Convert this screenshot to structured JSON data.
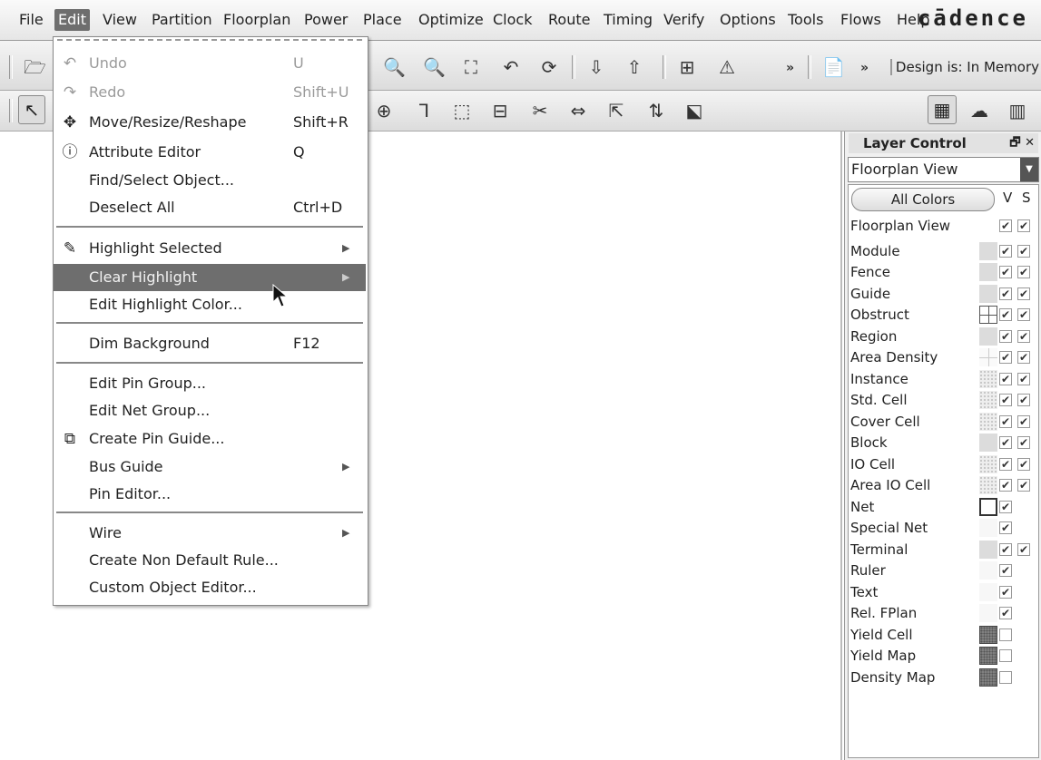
{
  "menubar": {
    "items": [
      "File",
      "Edit",
      "View",
      "Partition",
      "Floorplan",
      "Power",
      "Place",
      "Optimize",
      "Clock",
      "Route",
      "Timing",
      "Verify",
      "Options",
      "Tools",
      "Flows",
      "Help"
    ],
    "active": "Edit",
    "logo": "cādence"
  },
  "toolbar": {
    "design_status": "Design is: In Memory",
    "more_label": "»"
  },
  "edit_menu": {
    "items": [
      {
        "label": "Undo",
        "shortcut": "U",
        "icon": "undo-icon",
        "disabled": true
      },
      {
        "label": "Redo",
        "shortcut": "Shift+U",
        "icon": "redo-icon",
        "disabled": true
      },
      {
        "label": "Move/Resize/Reshape",
        "shortcut": "Shift+R",
        "icon": "move-icon"
      },
      {
        "label": "Attribute Editor",
        "shortcut": "Q",
        "icon": "info-icon"
      },
      {
        "label": "Find/Select Object...",
        "shortcut": ""
      },
      {
        "label": "Deselect All",
        "shortcut": "Ctrl+D"
      },
      {
        "label": "Highlight Selected",
        "shortcut": "",
        "icon": "highlight-icon",
        "submenu": true
      },
      {
        "label": "Clear Highlight",
        "shortcut": "",
        "submenu": true,
        "highlighted": true
      },
      {
        "label": "Edit Highlight Color...",
        "shortcut": ""
      },
      {
        "label": "Dim Background",
        "shortcut": "F12"
      },
      {
        "label": "Edit Pin Group...",
        "shortcut": ""
      },
      {
        "label": "Edit Net Group...",
        "shortcut": ""
      },
      {
        "label": "Create Pin Guide...",
        "shortcut": "",
        "icon": "pin-guide-icon"
      },
      {
        "label": "Bus Guide",
        "shortcut": "",
        "submenu": true
      },
      {
        "label": "Pin Editor...",
        "shortcut": ""
      },
      {
        "label": "Wire",
        "shortcut": "",
        "submenu": true
      },
      {
        "label": "Create Non Default Rule...",
        "shortcut": ""
      },
      {
        "label": "Custom Object Editor...",
        "shortcut": ""
      }
    ]
  },
  "layer_control": {
    "title": "Layer Control",
    "title_controls": "🗗 ✕",
    "view_select": "Floorplan View",
    "all_colors_label": "All Colors",
    "col_v": "V",
    "col_s": "S",
    "check_mark": "✔",
    "layers": [
      {
        "name": "Floorplan View",
        "swatch": "none",
        "v": true,
        "s": true
      },
      {
        "name": "Module",
        "swatch": "light",
        "v": true,
        "s": true
      },
      {
        "name": "Fence",
        "swatch": "light",
        "v": true,
        "s": true
      },
      {
        "name": "Guide",
        "swatch": "light",
        "v": true,
        "s": true
      },
      {
        "name": "Obstruct",
        "swatch": "grid",
        "v": true,
        "s": true
      },
      {
        "name": "Region",
        "swatch": "light",
        "v": true,
        "s": true
      },
      {
        "name": "Area Density",
        "swatch": "cross",
        "v": true,
        "s": true
      },
      {
        "name": "Instance",
        "swatch": "dot",
        "v": true,
        "s": true
      },
      {
        "name": "Std. Cell",
        "swatch": "dot",
        "v": true,
        "s": true
      },
      {
        "name": "Cover Cell",
        "swatch": "dot",
        "v": true,
        "s": true
      },
      {
        "name": "Block",
        "swatch": "light",
        "v": true,
        "s": true
      },
      {
        "name": "IO Cell",
        "swatch": "dot",
        "v": true,
        "s": true
      },
      {
        "name": "Area IO Cell",
        "swatch": "dot",
        "v": true,
        "s": true
      },
      {
        "name": "Net",
        "swatch": "outline",
        "v": true,
        "s": null
      },
      {
        "name": "Special Net",
        "swatch": "white",
        "v": true,
        "s": null
      },
      {
        "name": "Terminal",
        "swatch": "light",
        "v": true,
        "s": true
      },
      {
        "name": "Ruler",
        "swatch": "white",
        "v": true,
        "s": null
      },
      {
        "name": "Text",
        "swatch": "white",
        "v": true,
        "s": null
      },
      {
        "name": "Rel. FPlan",
        "swatch": "white",
        "v": true,
        "s": null
      },
      {
        "name": "Yield Cell",
        "swatch": "dark",
        "v": false,
        "s": null
      },
      {
        "name": "Yield Map",
        "swatch": "dark",
        "v": false,
        "s": null
      },
      {
        "name": "Density Map",
        "swatch": "dark",
        "v": false,
        "s": null
      }
    ]
  }
}
